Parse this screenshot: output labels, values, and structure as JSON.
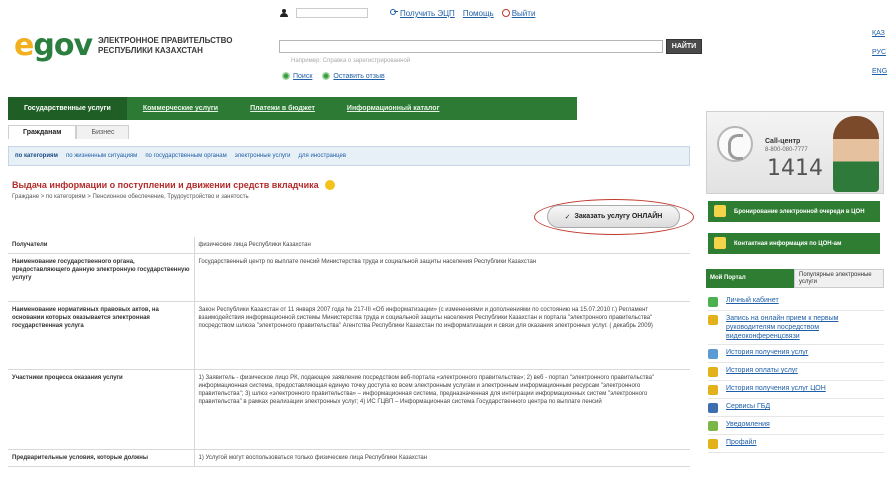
{
  "logo": {
    "mark_e": "e",
    "mark_rest": "gov",
    "text_line1": "ЭЛЕКТРОННОЕ ПРАВИТЕЛЬСТВО",
    "text_line2": "РЕСПУБЛИКИ КАЗАХСТАН"
  },
  "user_bar": {
    "register": "Получить ЭЦП",
    "help": "Помощь",
    "logout": "Выйти"
  },
  "search": {
    "button": "НАЙТИ",
    "hint": "Например: Справка о зарегистрированной",
    "option_search": "Поиск",
    "option_feedback": "Оставить отзыв"
  },
  "languages": [
    "ҚАЗ",
    "РУС",
    "ENG"
  ],
  "nav": [
    {
      "label": "Государственные услуги",
      "active": true
    },
    {
      "label": "Коммерческие услуги",
      "active": false
    },
    {
      "label": "Платежи в бюджет",
      "active": false
    },
    {
      "label": "Информационный каталог",
      "active": false
    }
  ],
  "tabs": [
    {
      "label": "Гражданам",
      "active": true
    },
    {
      "label": "Бизнес",
      "active": false
    }
  ],
  "subnav": [
    {
      "label": "по категориям",
      "active": true
    },
    {
      "label": "по жизненным ситуациям",
      "active": false
    },
    {
      "label": "по государственным органам",
      "active": false
    },
    {
      "label": "электронные услуги",
      "active": false
    },
    {
      "label": "для иностранцев",
      "active": false
    }
  ],
  "service": {
    "title": "Выдача информации о поступлении и движении средств вкладчика",
    "breadcrumb": "Граждане > по категориям > Пенсионное обеспечение, Трудоустройство и занятость",
    "order_button": "Заказать услугу ОНЛАЙН"
  },
  "table": [
    {
      "label": "Получатели",
      "value": "физические лица Республики Казахстан"
    },
    {
      "label": "Наименование государственного органа, предоставляющего данную электронную государственную услугу",
      "value": "Государственный центр по выплате пенсий Министерства труда и социальной защиты населения Республики Казахстан"
    },
    {
      "label": "Наименование нормативных правовых актов, на основании которых оказывается электронная государственная услуга",
      "value": "Закон Республики Казахстан от 11 января 2007 года № 217-III «Об информатизации» (с изменениями и дополнениями по состоянию на 15.07.2010 г.) Регламент взаимодействия информационной системы Министерства труда и социальной защиты населения Республики Казахстан и портала \"электронного правительства\" посредством шлюза \"электронного правительства\" Агентства Республики Казахстан по информатизации и связи для оказания электронных услуг. ( декабрь 2009)"
    },
    {
      "label": "Участники процесса оказания услуги",
      "value": "1) Заявитель - физическое лицо РК, подающее заявление посредством веб-портала «электронного правительства»; 2) веб - портал \"электронного правительства\" информационная система, предоставляющая единую точку доступа ко всем электронным услугам и электронным информационным ресурсам \"электронного правительства\"; 3) шлюз «электронного правительства» – информационная система, предназначенная для интеграции информационных систем \"электронного правительства\" в рамках реализации электронных услуг; 4) ИС ГЦВП – Информационная система Государственного центра по выплате пенсий"
    },
    {
      "label": "Предварительные условия, которые должны",
      "value": "1) Услугой могут воспользоваться только физические лица Республики Казахстан"
    }
  ],
  "callcenter": {
    "title": "Call-центр",
    "phone": "8-800-080-7777",
    "short": "1414"
  },
  "banners": [
    {
      "label": "Бронирование электронной очереди в ЦОН"
    },
    {
      "label": "Контактная информация по ЦОН-ам"
    }
  ],
  "portal_tabs": [
    {
      "label": "Мой Портал",
      "active": true
    },
    {
      "label": "Популярные электронные услуги",
      "active": false
    }
  ],
  "portal_items": [
    {
      "label": "Личный кабинет",
      "icon": "home-icon",
      "color": "#4caf50"
    },
    {
      "label": "Запись на онлайн прием к первым руководителям посредством видеоконференцсвязи",
      "icon": "money-icon",
      "color": "#e3b11a"
    },
    {
      "label": "История получения услуг",
      "icon": "history-icon",
      "color": "#5b9bd5"
    },
    {
      "label": "История оплаты услуг",
      "icon": "payment-icon",
      "color": "#e3b11a"
    },
    {
      "label": "История получения услуг ЦОН",
      "icon": "con-history-icon",
      "color": "#e3b11a"
    },
    {
      "label": "Сервисы ГБД",
      "icon": "database-icon",
      "color": "#3d6fb0"
    },
    {
      "label": "Уведомления",
      "icon": "notification-icon",
      "color": "#7ab648"
    },
    {
      "label": "Профайл",
      "icon": "profile-icon",
      "color": "#e3b11a"
    }
  ]
}
